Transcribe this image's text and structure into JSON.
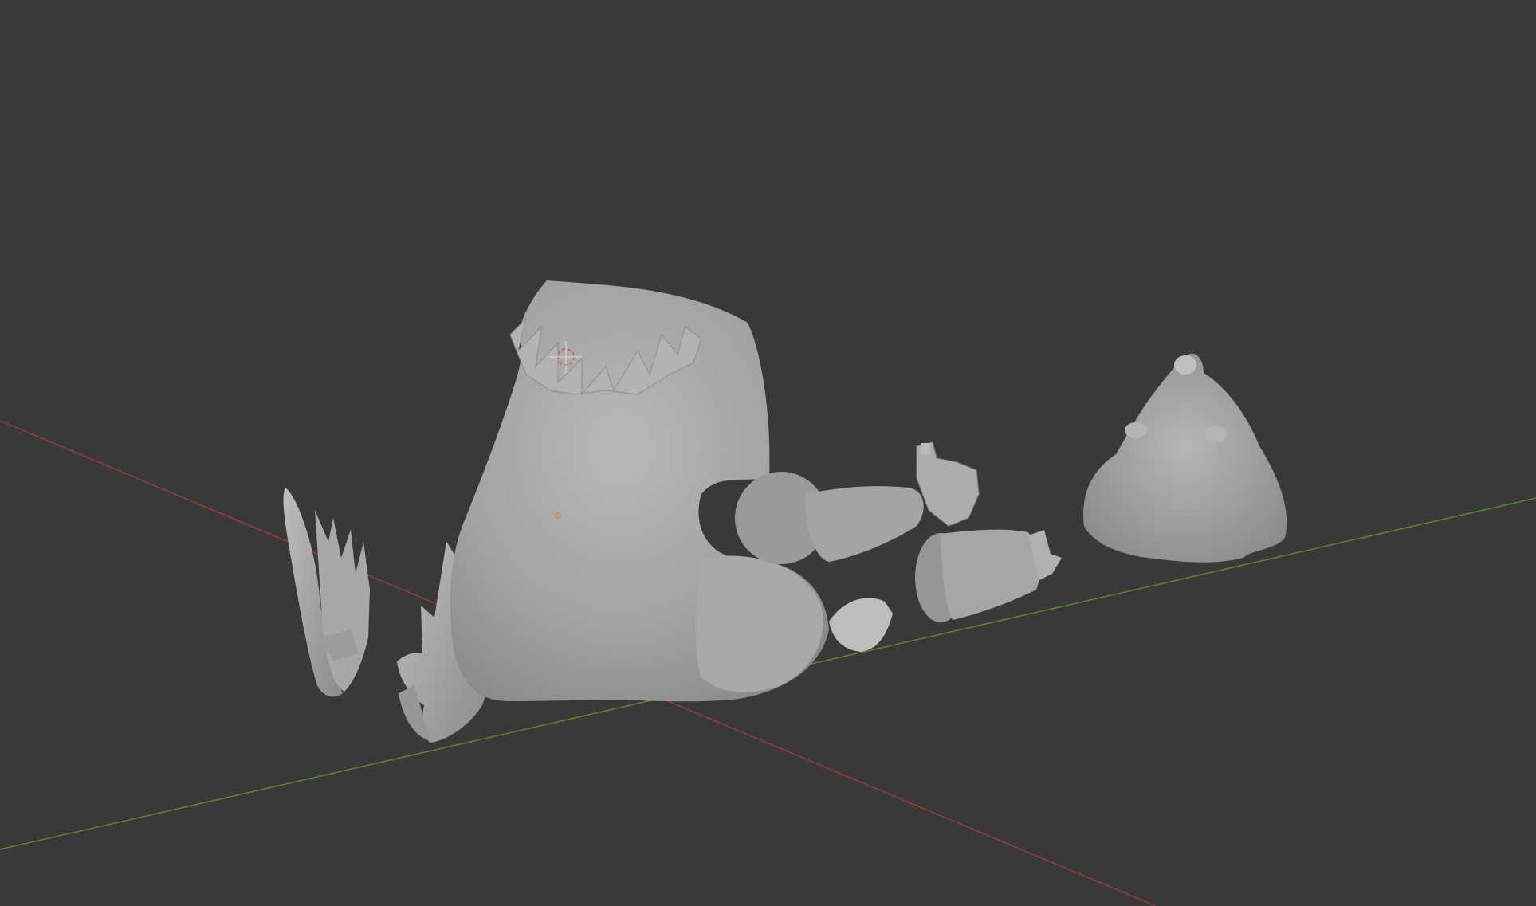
{
  "app": {
    "name": "3D viewport",
    "background_color": "#393939"
  },
  "viewport": {
    "shading": "solid",
    "axes": {
      "x_axis_color": "#9a3c3c",
      "y_axis_color": "#5f8a2e"
    },
    "objects": [
      {
        "name": "torso",
        "kind": "mesh",
        "color": "#a6a6a6"
      },
      {
        "name": "left-foot",
        "kind": "mesh",
        "color": "#a6a6a6"
      },
      {
        "name": "right-foot",
        "kind": "mesh",
        "color": "#a6a6a6"
      },
      {
        "name": "arm-upper",
        "kind": "mesh",
        "color": "#a6a6a6"
      },
      {
        "name": "arm-lower",
        "kind": "mesh",
        "color": "#a6a6a6"
      },
      {
        "name": "head",
        "kind": "mesh",
        "color": "#a6a6a6"
      }
    ],
    "cursor": {
      "name": "3d-cursor",
      "color": "#d94a4a"
    },
    "origin_marker": {
      "color": "#e08a1c"
    }
  }
}
